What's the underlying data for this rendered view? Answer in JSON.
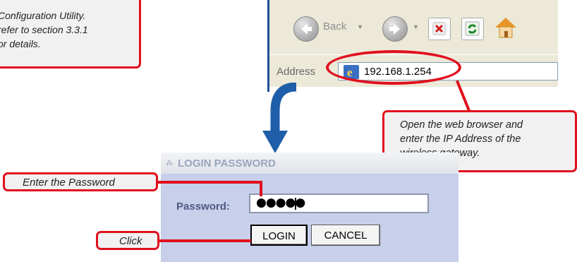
{
  "note_callout": {
    "lines": [
      "Configuration Utility.",
      "refer to section 3.3.1",
      "or details."
    ],
    "partial_top_line": "the Configuration Utility"
  },
  "browser": {
    "back_label": "Back",
    "address_label": "Address",
    "url": "192.168.1.254"
  },
  "browser_callout": {
    "lines": [
      "Open the web browser and",
      "enter the IP Address of the",
      "wireless gateway."
    ]
  },
  "login": {
    "title": "LOGIN PASSWORD",
    "password_label": "Password:",
    "password_value": "●●●●●",
    "login_label": "LOGIN",
    "cancel_label": "CANCEL"
  },
  "password_callout": {
    "text": "Enter the Password"
  },
  "click_callout": {
    "text": "Click"
  },
  "colors": {
    "callout_border": "#e0101e",
    "login_panel_bg": "#c7cfea",
    "arrow": "#1f5ea8"
  }
}
